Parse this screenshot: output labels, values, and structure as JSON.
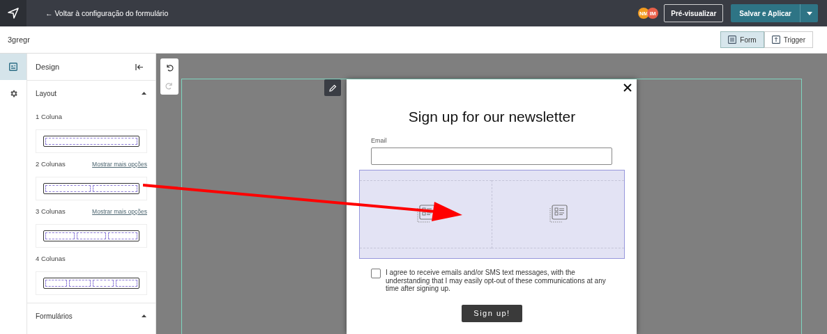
{
  "topbar": {
    "back_link": "← Voltar à configuração do formulário",
    "avatars": [
      {
        "initials": "NM",
        "color": "#f39c1f"
      },
      {
        "initials": "IM",
        "color": "#e8604a"
      }
    ],
    "preview_button": "Pré-visualizar",
    "save_button": "Salvar e Aplicar"
  },
  "subbar": {
    "form_name": "3gregr",
    "view_tabs": [
      {
        "label": "Form",
        "kind": "form",
        "selected": true
      },
      {
        "label": "Trigger",
        "kind": "trigger",
        "selected": false
      }
    ]
  },
  "rail": [
    {
      "kind": "design",
      "selected": true
    },
    {
      "kind": "settings",
      "selected": false
    }
  ],
  "panel": {
    "title": "Design",
    "sections": [
      {
        "title": "Layout",
        "expanded": true,
        "layouts": [
          {
            "label": "1 Coluna",
            "kind": "single"
          },
          {
            "label": "2 Colunas",
            "kind": "double",
            "more_link": "Mostrar mais opções"
          },
          {
            "label": "3 Colunas",
            "kind": "triple",
            "more_link": "Mostrar mais opções"
          },
          {
            "label": "4 Colunas",
            "kind": "quad"
          }
        ]
      },
      {
        "title": "Formulários",
        "expanded": true
      }
    ]
  },
  "popup": {
    "title": "Sign up for our newsletter",
    "email_label": "Email",
    "column_slots": [
      {
        "kind": "empty"
      },
      {
        "kind": "empty"
      }
    ],
    "consent": {
      "checked": false,
      "text": "I agree to receive emails and/or SMS text messages, with the understanding that I may easily opt-out of these communications at any time after signing up."
    },
    "submit": "Sign up!"
  }
}
